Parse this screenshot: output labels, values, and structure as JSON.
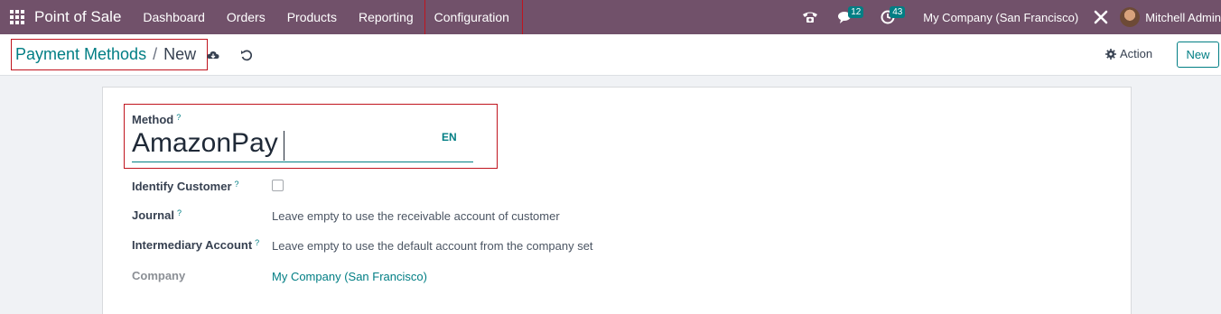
{
  "navbar": {
    "app_title": "Point of Sale",
    "menu": [
      "Dashboard",
      "Orders",
      "Products",
      "Reporting",
      "Configuration"
    ],
    "messages_badge": "12",
    "activities_badge": "43",
    "company": "My Company (San Francisco)",
    "user": "Mitchell Admin"
  },
  "control_panel": {
    "breadcrumb_parent": "Payment Methods",
    "breadcrumb_sep": "/",
    "breadcrumb_current": "New",
    "action_label": "Action",
    "new_label": "New"
  },
  "form": {
    "method_label": "Method",
    "method_value": "AmazonPay",
    "lang": "EN",
    "help_mark": "?",
    "identify_customer_label": "Identify Customer",
    "identify_customer_checked": false,
    "journal_label": "Journal",
    "journal_placeholder": "Leave empty to use the receivable account of customer",
    "intermediary_label": "Intermediary Account",
    "intermediary_placeholder": "Leave empty to use the default account from the company set",
    "company_label": "Company",
    "company_value": "My Company (San Francisco)"
  },
  "colors": {
    "navbar": "#71516a",
    "accent": "#017e84",
    "highlight": "#c0141e"
  }
}
